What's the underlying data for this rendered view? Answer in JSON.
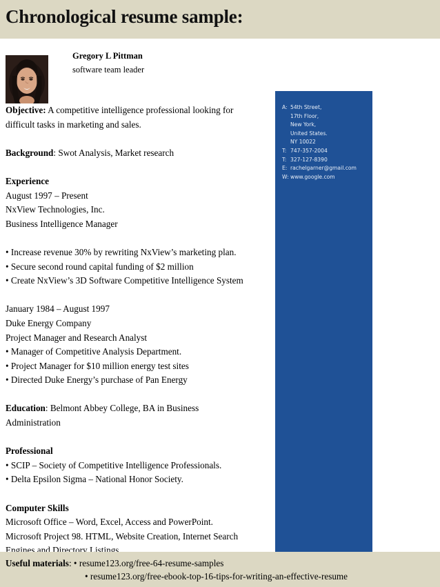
{
  "header": {
    "title": "Chronological resume sample:",
    "band_color": "#dcd8c3"
  },
  "candidate": {
    "photo_alt": "candidate-portrait",
    "name": "Gregory L Pittman",
    "job_title": "software team leader"
  },
  "sections": {
    "objective": {
      "label": "Objective:",
      "lines": [
        "A competitive intelligence professional looking for",
        "difficult tasks in marketing and sales."
      ]
    },
    "background": {
      "label": "Background",
      "separator": ":",
      "text": "Swot Analysis, Market research"
    },
    "experience": {
      "heading": "Experience",
      "jobs": [
        {
          "dates": "August 1997 – Present",
          "company": "NxView Technologies, Inc.",
          "role": "Business Intelligence Manager",
          "bullets": [
            "• Increase revenue 30% by rewriting NxView’s marketing plan.",
            "• Secure second round capital funding of $2 million",
            "• Create NxView’s 3D Software Competitive Intelligence System"
          ]
        },
        {
          "dates": "January 1984 – August 1997",
          "company": "Duke Energy Company",
          "role": "Project Manager and Research Analyst",
          "bullets": [
            "• Manager of Competitive Analysis Department.",
            "• Project Manager for $10 million energy test sites",
            "• Directed Duke Energy’s purchase of Pan Energy"
          ]
        }
      ]
    },
    "education": {
      "label": "Education",
      "separator": ":",
      "lines": [
        "Belmont Abbey College, BA in Business",
        "Administration"
      ]
    },
    "professional": {
      "heading": "Professional",
      "bullets": [
        "• SCIP – Society of Competitive Intelligence Professionals.",
        "• Delta Epsilon Sigma – National Honor Society."
      ]
    },
    "computer_skills": {
      "heading": "Computer Skills",
      "lines": [
        "Microsoft Office – Word, Excel, Access and PowerPoint.",
        "Microsoft Project 98. HTML, Website Creation, Internet Search",
        "Engines and Directory Listings."
      ]
    }
  },
  "contact_card": {
    "background_color": "#1f5196",
    "text_color": "#e8eef7",
    "rows": [
      {
        "key": "A:",
        "value": "54th Street,"
      },
      {
        "key": "",
        "value": "17th Floor,"
      },
      {
        "key": "",
        "value": "New York,"
      },
      {
        "key": "",
        "value": "United States."
      },
      {
        "key": "",
        "value": "NY 10022"
      },
      {
        "key": "T:",
        "value": "747-357-2004"
      },
      {
        "key": "T:",
        "value": "327-127-8390"
      },
      {
        "key": "E:",
        "value": "rachelgarner@gmail.com"
      },
      {
        "key": "W:",
        "value": "www.google.com"
      }
    ]
  },
  "footer": {
    "band_color": "#dcd8c3",
    "label": "Useful materials",
    "separator": ":",
    "link1": "• resume123.org/free-64-resume-samples",
    "link2": "• resume123.org/free-ebook-top-16-tips-for-writing-an-effective-resume"
  }
}
